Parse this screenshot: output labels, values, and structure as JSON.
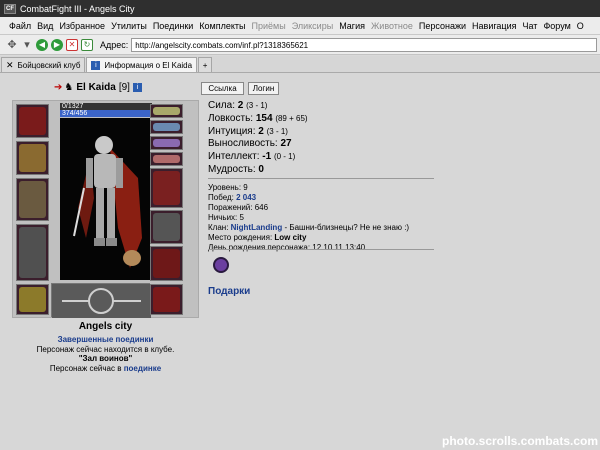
{
  "window": {
    "app_icon": "CF",
    "title": "CombatFight III - Angels City"
  },
  "menu": [
    {
      "label": "Файл",
      "disabled": false
    },
    {
      "label": "Вид",
      "disabled": false
    },
    {
      "label": "Избранное",
      "disabled": false
    },
    {
      "label": "Утилиты",
      "disabled": false
    },
    {
      "label": "Поединки",
      "disabled": false
    },
    {
      "label": "Комплекты",
      "disabled": false
    },
    {
      "label": "Приёмы",
      "disabled": true
    },
    {
      "label": "Эликсиры",
      "disabled": true
    },
    {
      "label": "Магия",
      "disabled": false
    },
    {
      "label": "Животное",
      "disabled": true
    },
    {
      "label": "Персонажи",
      "disabled": false
    },
    {
      "label": "Навигация",
      "disabled": false
    },
    {
      "label": "Чат",
      "disabled": false
    },
    {
      "label": "Форум",
      "disabled": false
    },
    {
      "label": "О",
      "disabled": false
    }
  ],
  "toolbar": {
    "address_label": "Адрес:",
    "address_value": "http://angelscity.combats.com/inf.pl?1318365621"
  },
  "tabs": [
    {
      "label": "Бойцовский клуб"
    },
    {
      "label": "Информация о El Kaida"
    }
  ],
  "character": {
    "name": "El Kaida",
    "level": "[9]",
    "info_badge": "i",
    "hp": "0/1327",
    "mana": "374/456",
    "city": "Angels city",
    "finished_fights": "Завершенные поединки",
    "status_line": "Персонаж сейчас находится в клубе.",
    "room": "\"Зал воинов\"",
    "fight_prefix": "Персонаж сейчас в",
    "fight_link": "поединке"
  },
  "buttons": {
    "link": "Ссылка",
    "logins": "Логин"
  },
  "stats": [
    {
      "label": "Сила:",
      "value": "2",
      "extra": "(3 - 1)"
    },
    {
      "label": "Ловкость:",
      "value": "154",
      "extra": "(89 + 65)"
    },
    {
      "label": "Интуиция:",
      "value": "2",
      "extra": "(3 - 1)"
    },
    {
      "label": "Выносливость:",
      "value": "27",
      "extra": ""
    },
    {
      "label": "Интеллект:",
      "value": "-1",
      "extra": "(0 - 1)"
    },
    {
      "label": "Мудрость:",
      "value": "0",
      "extra": ""
    }
  ],
  "details": {
    "level_label": "Уровень:",
    "level_value": "9",
    "wins_label": "Побед:",
    "wins_value": "2 043",
    "losses_label": "Поражений:",
    "losses_value": "646",
    "draws_label": "Ничьих:",
    "draws_value": "5",
    "clan_label": "Клан:",
    "clan_value": "NightLanding",
    "clan_extra": "- Башни-близнецы? Не не знаю :)",
    "birthplace_label": "Место рождения:",
    "birthplace_value": "Low city",
    "birthday_label": "День рождения персонажа:",
    "birthday_value": "12.10.11 13:40"
  },
  "gifts": "Подарки",
  "watermark": "photo.scrolls.combats.com"
}
